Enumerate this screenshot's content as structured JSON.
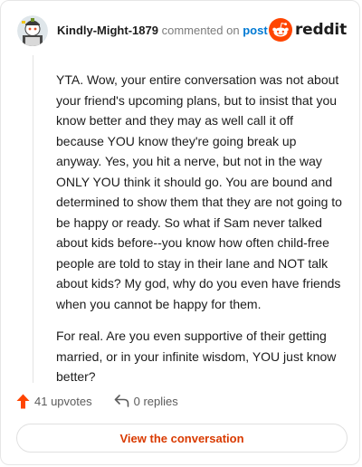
{
  "comment": {
    "author": "Kindly-Might-1879",
    "action_text": "commented on",
    "target_link": "post",
    "paragraphs": [
      "YTA. Wow, your entire conversation was not about your friend's upcoming plans, but to insist that you know better and they may as well call it off because YOU know they're going break up anyway. Yes, you hit a nerve, but not in the way ONLY YOU think it should go. You are bound and determined to show them that they are not going to be happy or ready. So what if Sam never talked about kids before--you know how often child-free people are told to stay in their lane and NOT talk about kids? My god, why do you even have friends when you cannot be happy for them.",
      "For real. Are you even supportive of their getting married, or in your infinite wisdom, YOU just know better?"
    ]
  },
  "brand": {
    "wordmark": "reddit",
    "logo_icon": "reddit-snoo-icon",
    "accent": "#ff4500"
  },
  "stats": {
    "upvotes": "41 upvotes",
    "replies": "0 replies"
  },
  "cta": {
    "label": "View the conversation",
    "color": "#d93a00"
  },
  "colors": {
    "link": "#0079d3",
    "upvote": "#ff4500"
  }
}
